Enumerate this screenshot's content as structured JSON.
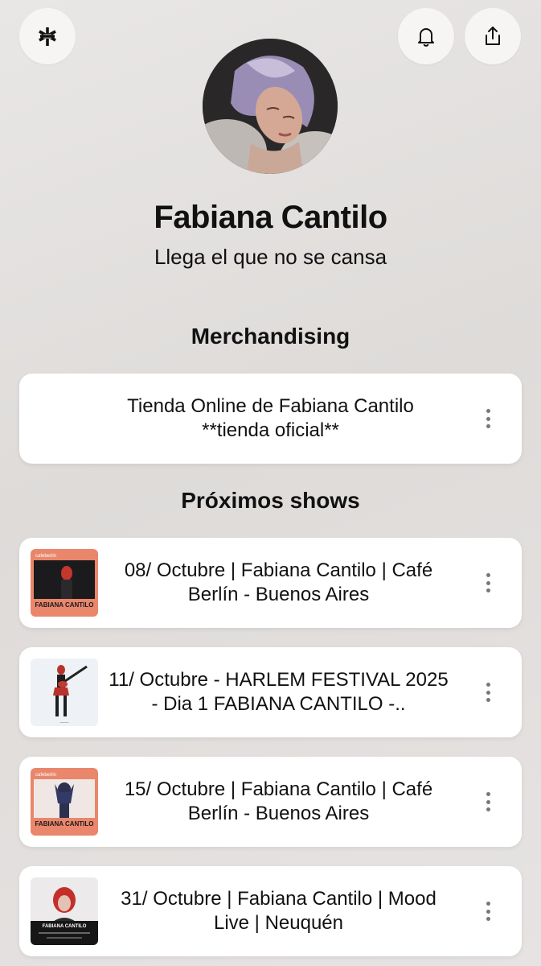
{
  "header": {
    "logo_icon": "linktree-asterisk-icon",
    "notify_icon": "bell-icon",
    "share_icon": "share-icon"
  },
  "profile": {
    "name": "Fabiana Cantilo",
    "bio": "Llega el que no se cansa"
  },
  "sections": {
    "merch_title": "Merchandising",
    "shows_title": "Próximos shows"
  },
  "merch_links": [
    {
      "label": "Tienda Online de Fabiana Cantilo **tienda oficial**",
      "menu_icon": "more-vertical-icon"
    }
  ],
  "show_links": [
    {
      "label": "08/ Octubre | Fabiana Cantilo | Café Berlín - Buenos Aires",
      "thumb": "cafe-berlin-poster",
      "thumb_text": "FABIANA CANTILO",
      "menu_icon": "more-vertical-icon"
    },
    {
      "label": "11/ Octubre - HARLEM FESTIVAL 2025 - Dia 1 FABIANA CANTILO -..",
      "thumb": "guitar-performer-photo",
      "menu_icon": "more-vertical-icon"
    },
    {
      "label": "15/ Octubre | Fabiana Cantilo | Café Berlín - Buenos Aires",
      "thumb": "cafe-berlin-poster",
      "thumb_text": "FABIANA CANTILO",
      "menu_icon": "more-vertical-icon"
    },
    {
      "label": "31/ Octubre | Fabiana Cantilo | Mood Live | Neuquén",
      "thumb": "mood-live-poster",
      "thumb_text": "FABIANA CANTILO",
      "menu_icon": "more-vertical-icon"
    }
  ],
  "colors": {
    "card_bg": "#ffffff",
    "page_bg": "#e4e1e0",
    "text": "#111111",
    "poster_salmon": "#e9866b"
  }
}
